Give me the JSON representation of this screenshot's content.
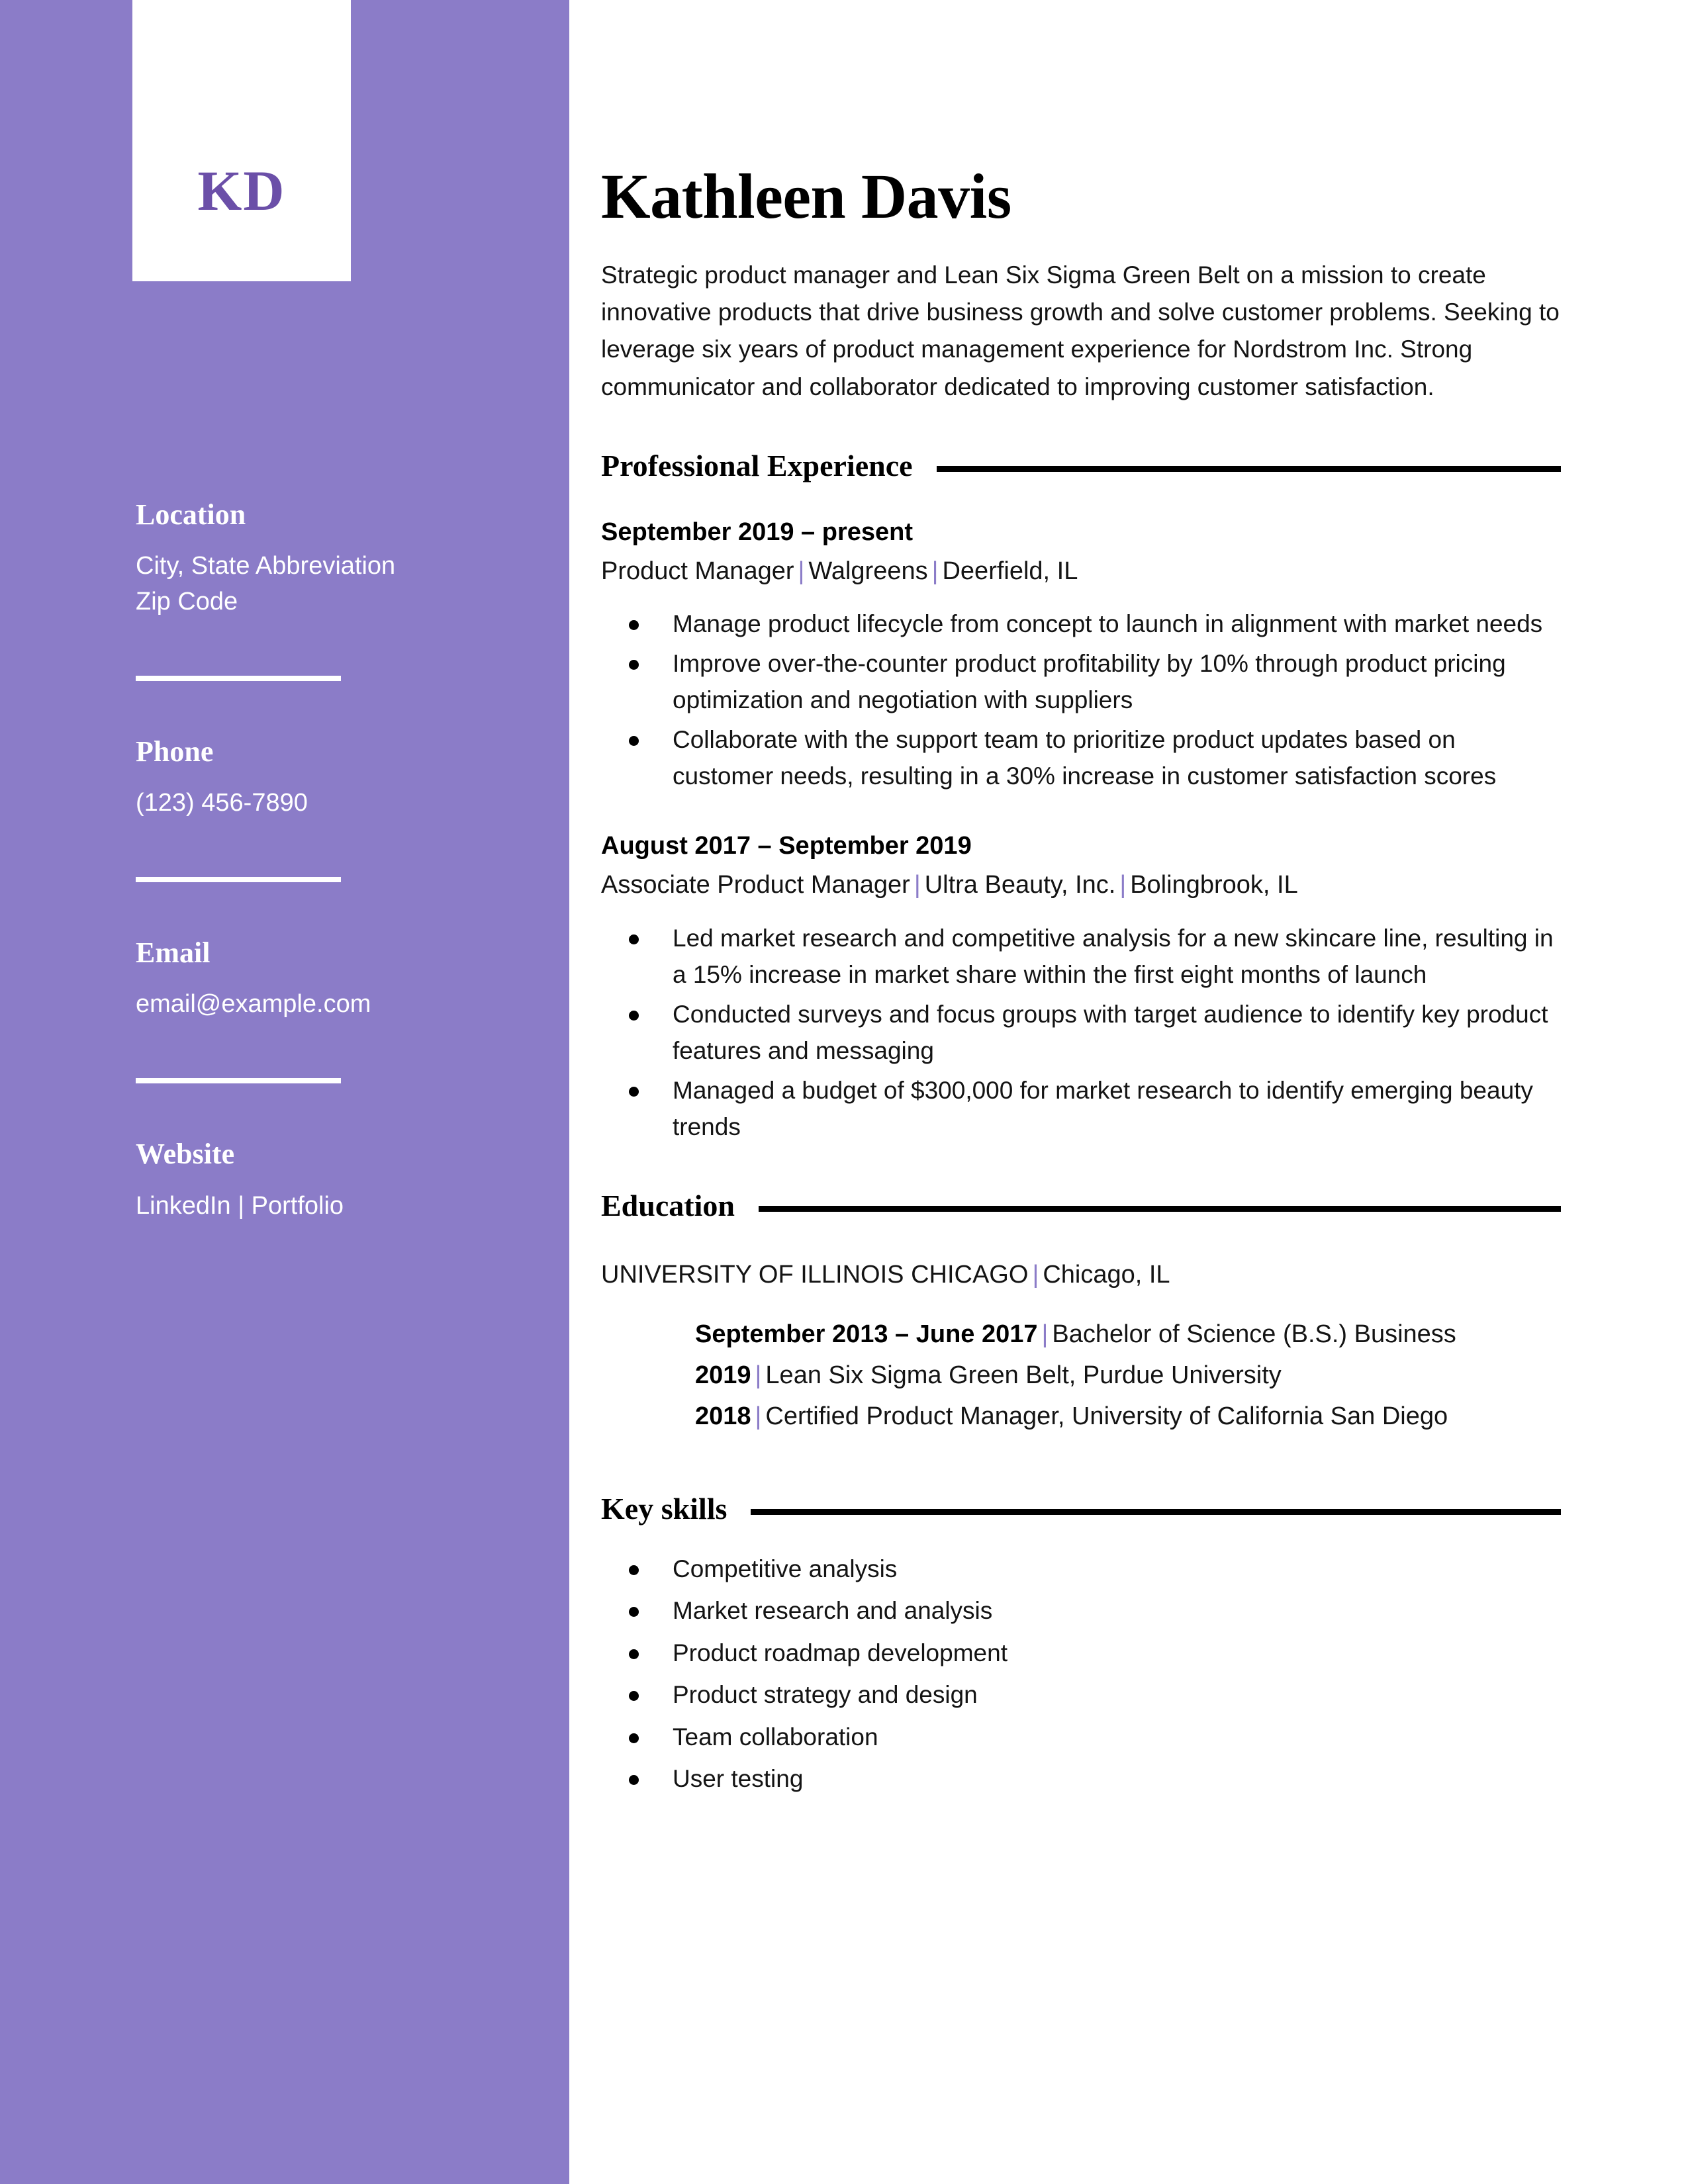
{
  "sidebar": {
    "monogram": "KD",
    "accent_color": "#8B7CC8",
    "contact": [
      {
        "heading": "Location",
        "lines": [
          "City, State Abbreviation",
          "Zip Code"
        ]
      },
      {
        "heading": "Phone",
        "lines": [
          "(123) 456-7890"
        ]
      },
      {
        "heading": "Email",
        "lines": [
          "email@example.com"
        ]
      },
      {
        "heading": "Website",
        "lines": [
          "LinkedIn | Portfolio"
        ]
      }
    ]
  },
  "main": {
    "name": "Kathleen Davis",
    "summary": "Strategic product manager and Lean Six Sigma Green Belt on a mission to create innovative products that drive business growth and solve customer problems. Seeking to leverage six years of product management experience for Nordstrom Inc. Strong communicator and collaborator dedicated to improving customer satisfaction.",
    "sections": {
      "experience": {
        "title": "Professional Experience",
        "jobs": [
          {
            "dates": "September 2019 – present",
            "role": "Product Manager",
            "company": "Walgreens",
            "location": "Deerfield, IL",
            "bullets": [
              "Manage product lifecycle from concept to launch in alignment with market needs",
              "Improve over-the-counter product profitability by 10% through product pricing optimization and negotiation with suppliers",
              "Collaborate with the support team to prioritize product updates based on customer needs, resulting in a 30% increase in customer satisfaction scores"
            ]
          },
          {
            "dates": "August 2017 – September 2019",
            "role": "Associate Product Manager",
            "company": "Ultra Beauty, Inc.",
            "location": "Bolingbrook, IL",
            "bullets": [
              "Led market research and competitive analysis for a new skincare line, resulting in a 15% increase in market share within the first eight months of launch",
              "Conducted surveys and focus groups with target audience to identify key product features and messaging",
              "Managed a budget of $300,000 for market research to identify emerging beauty trends"
            ]
          }
        ]
      },
      "education": {
        "title": "Education",
        "school": "UNIVERSITY OF ILLINOIS CHICAGO",
        "school_location": "Chicago, IL",
        "entries": [
          {
            "date": "September 2013 – June 2017",
            "detail": "Bachelor of Science (B.S.) Business"
          },
          {
            "date": "2019",
            "detail": "Lean Six Sigma Green Belt, Purdue University"
          },
          {
            "date": "2018",
            "detail": "Certified Product Manager, University of California San Diego"
          }
        ]
      },
      "skills": {
        "title": "Key skills",
        "items": [
          "Competitive analysis",
          "Market research and analysis",
          "Product roadmap development",
          "Product strategy and design",
          "Team collaboration",
          "User testing"
        ]
      }
    }
  }
}
